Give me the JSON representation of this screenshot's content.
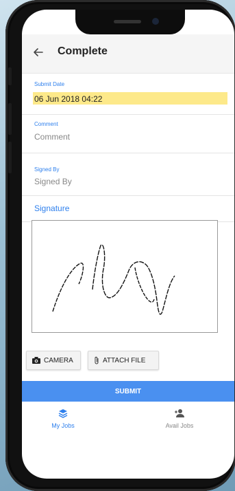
{
  "header": {
    "title": "Complete"
  },
  "fields": {
    "submit_date": {
      "label": "Submit Date",
      "value": "06 Jun 2018 04:22"
    },
    "comment": {
      "label": "Comment",
      "placeholder": "Comment"
    },
    "signed_by": {
      "label": "Signed By",
      "placeholder": "Signed By"
    }
  },
  "signature": {
    "label": "Signature"
  },
  "actions": {
    "camera_label": "CAMERA",
    "attach_label": "ATTACH FILE",
    "submit_label": "SUBMIT"
  },
  "tabs": [
    {
      "label": "My Jobs",
      "icon": "layers-icon",
      "active": true
    },
    {
      "label": "Avail Jobs",
      "icon": "add-person-icon",
      "active": false
    }
  ],
  "colors": {
    "accent": "#2f80ed",
    "submit": "#4a90f0",
    "highlight": "#fde98a"
  }
}
